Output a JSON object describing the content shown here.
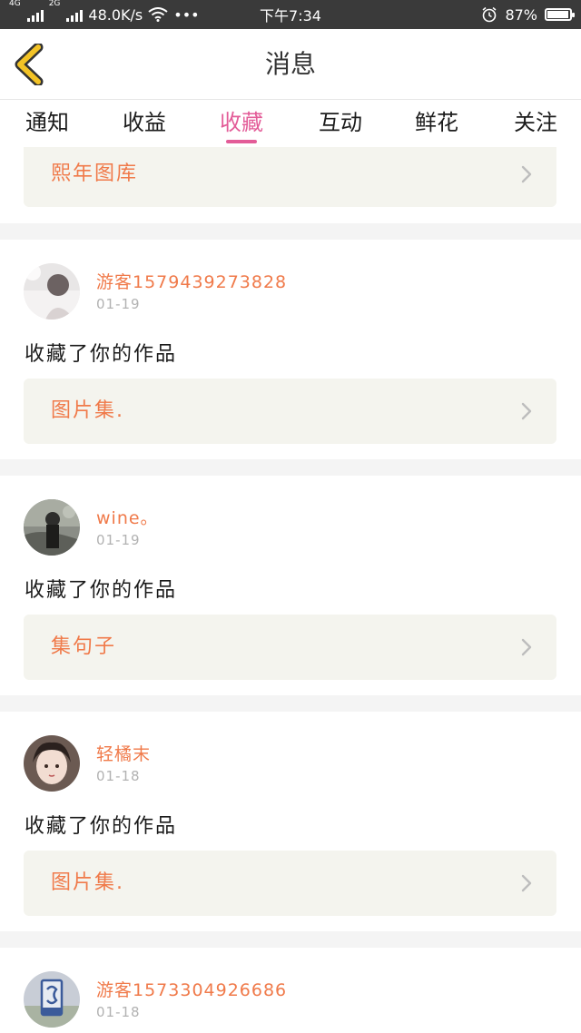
{
  "status_bar": {
    "net_a": "4G",
    "net_b": "2G",
    "speed": "48.0K/s",
    "dots": "•••",
    "time": "下午7:34",
    "battery": "87%",
    "battery_level": 0.87
  },
  "header": {
    "title": "消息",
    "back_icon": "chevron-left-icon",
    "accent_color": "#f3c326"
  },
  "tabs": [
    {
      "label": "通知",
      "active": false
    },
    {
      "label": "收益",
      "active": false
    },
    {
      "label": "收藏",
      "active": true
    },
    {
      "label": "互动",
      "active": false
    },
    {
      "label": "鲜花",
      "active": false
    },
    {
      "label": "关注",
      "active": false
    }
  ],
  "colors": {
    "active_tab": "#e35c98",
    "username": "#f07a4a",
    "work_title": "#f07a4a",
    "date": "#b2b2b2",
    "card_bg": "#ffffff",
    "work_bg": "#f4f4ee"
  },
  "top_partial": {
    "work_title": "熙年图库"
  },
  "items": [
    {
      "username": "游客1579439273828",
      "date": "01-19",
      "action": "收藏了你的作品",
      "work_title": "图片集."
    },
    {
      "username": "wine。",
      "date": "01-19",
      "action": "收藏了你的作品",
      "work_title": "集句子"
    },
    {
      "username": "轻橘末",
      "date": "01-18",
      "action": "收藏了你的作品",
      "work_title": "图片集."
    },
    {
      "username": "游客1573304926686",
      "date": "01-18"
    }
  ]
}
